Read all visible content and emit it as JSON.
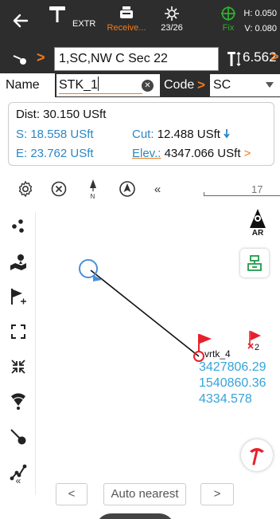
{
  "topbar": {
    "mode_label": "EXTR",
    "receiver_label": "Receive...",
    "satellites": "23/26",
    "fix_label": "Fix",
    "h_precision": "H: 0.050",
    "v_precision": "V: 0.080"
  },
  "point_row": {
    "point_text": "1,SC,NW C Sec 22",
    "height_value": "6.562"
  },
  "name_row": {
    "name_label": "Name",
    "name_value": "STK_1",
    "code_label": "Code",
    "code_value": "SC"
  },
  "info": {
    "dist": "Dist: 30.150 USft",
    "s": "S: 18.558 USft",
    "cut_label": "Cut:",
    "cut_value": "12.488 USft",
    "e": "E: 23.762 USft",
    "elev_label": "Elev.:",
    "elev_value": "4347.066 USft"
  },
  "map": {
    "scale_label": "17",
    "point_vrtk": "vrtk_4",
    "point_x2": "2",
    "coord_n": "3427806.29",
    "coord_e": "1540860.36",
    "coord_z": "4334.578",
    "ar_label": "AR"
  },
  "bottom": {
    "prev_label": "<",
    "auto_label": "Auto nearest",
    "next_label": ">"
  },
  "colors": {
    "accent": "#f27a1a",
    "blue_text": "#2a87c6",
    "coord_text": "#35a4d8",
    "fix_green": "#2fae2f",
    "flag_red": "#e8202a",
    "topbar_bg": "#2d2d2d"
  }
}
